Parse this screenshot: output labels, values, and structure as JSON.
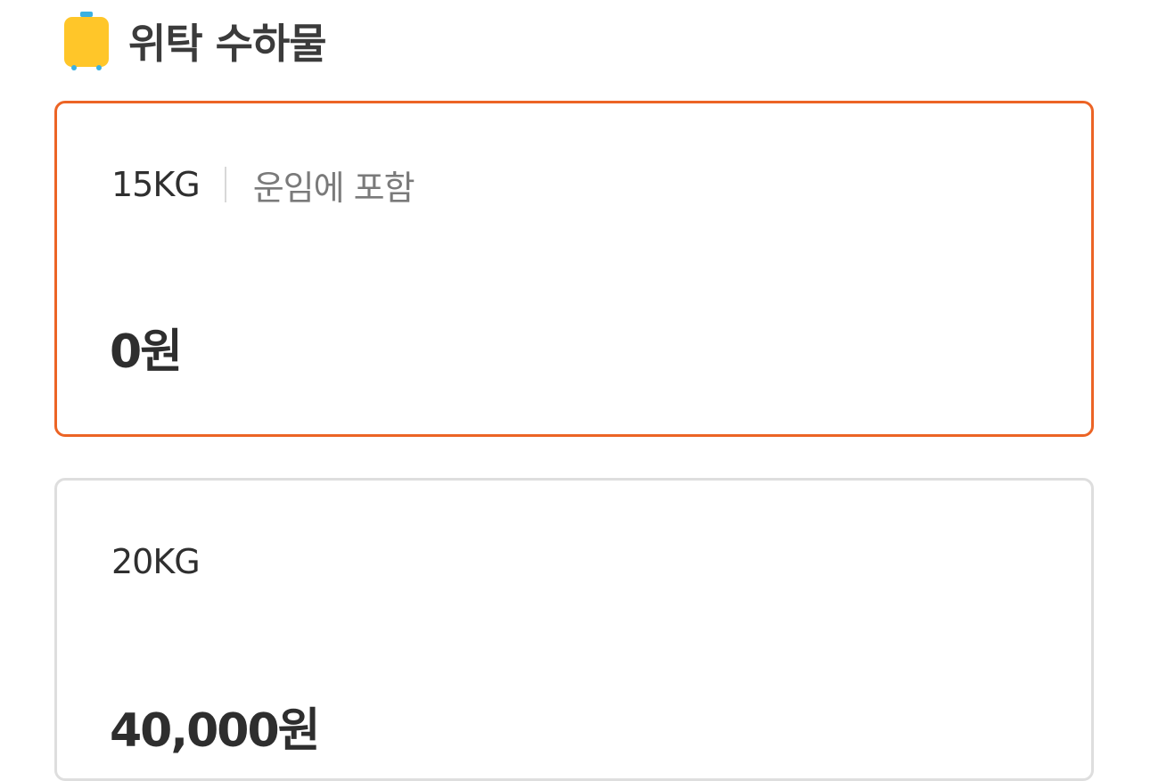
{
  "section": {
    "icon": "luggage-icon",
    "title": "위탁 수하물"
  },
  "colors": {
    "selected_border": "#ec6425",
    "unselected_border": "#dedede",
    "icon_body": "#ffc629",
    "icon_accent": "#3ab0e2"
  },
  "options": [
    {
      "weight": "15KG",
      "note": "운임에 포함",
      "price": "0원",
      "selected": true
    },
    {
      "weight": "20KG",
      "price": "40,000원",
      "selected": false
    }
  ]
}
